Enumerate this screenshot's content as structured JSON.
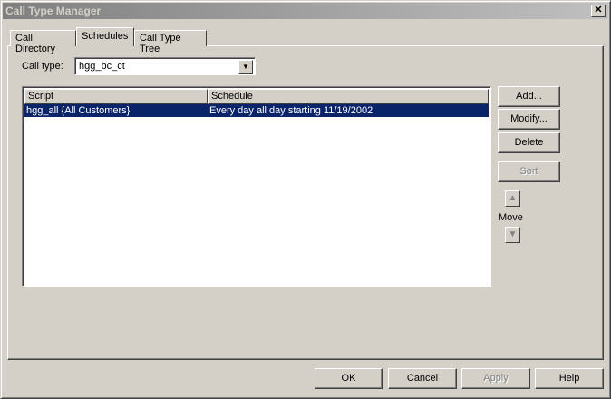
{
  "window": {
    "title": "Call Type Manager",
    "close": "✕"
  },
  "tabs": [
    {
      "label": "Call Directory"
    },
    {
      "label": "Schedules"
    },
    {
      "label": "Call Type Tree"
    }
  ],
  "call_type": {
    "label": "Call type:",
    "value": "hgg_bc_ct"
  },
  "table": {
    "columns": [
      "Script",
      "Schedule"
    ],
    "rows": [
      {
        "script": "hgg_all {All Customers}",
        "schedule": "Every day all day starting 11/19/2002"
      }
    ]
  },
  "side_buttons": {
    "add": "Add...",
    "modify": "Modify...",
    "delete": "Delete",
    "sort": "Sort",
    "move": "Move"
  },
  "bottom_buttons": {
    "ok": "OK",
    "cancel": "Cancel",
    "apply": "Apply",
    "help": "Help"
  }
}
